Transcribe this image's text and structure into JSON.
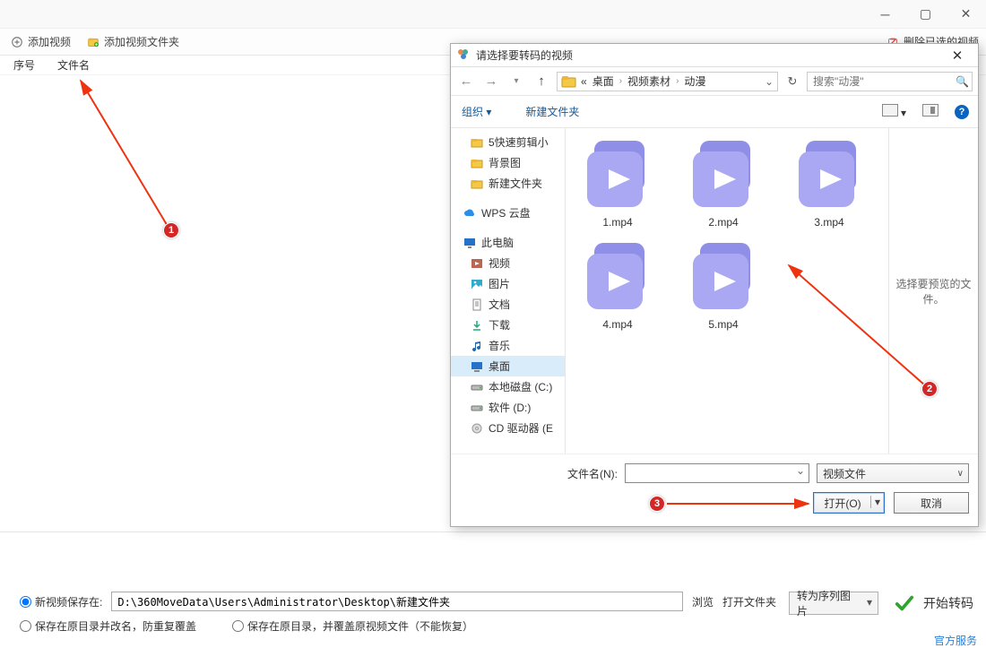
{
  "main_toolbar": {
    "add_video": "添加视频",
    "add_folder": "添加视频文件夹",
    "delete_selected": "删除已选的视频"
  },
  "table": {
    "seq": "序号",
    "filename": "文件名"
  },
  "annotations": {
    "b1": "1",
    "b2": "2",
    "b3": "3"
  },
  "bottom": {
    "save_new_label": "新视频保存在:",
    "save_path": "D:\\360MoveData\\Users\\Administrator\\Desktop\\新建文件夹",
    "browse": "浏览",
    "open_folder": "打开文件夹",
    "rename_label": "保存在原目录并改名，防重复覆盖",
    "overwrite_label": "保存在原目录，并覆盖原视频文件（不能恢复）",
    "seq_img": "转为序列图片",
    "start": "开始转码"
  },
  "footer_link": "官方服务",
  "dialog": {
    "title": "请选择要转码的视频",
    "breadcrumb": {
      "prefix": "«",
      "seg1": "桌面",
      "seg2": "视频素材",
      "seg3": "动漫"
    },
    "search_placeholder": "搜索\"动漫\"",
    "organize": "组织",
    "new_folder": "新建文件夹",
    "tree": {
      "quick": "5快速剪辑小",
      "bg": "背景图",
      "newdir": "新建文件夹",
      "wps": "WPS 云盘",
      "thisPC": "此电脑",
      "video": "视频",
      "pictures": "图片",
      "docs": "文档",
      "downloads": "下载",
      "music": "音乐",
      "desktop": "桌面",
      "c_drive": "本地磁盘 (C:)",
      "d_drive": "软件 (D:)",
      "cd_drive": "CD 驱动器 (E"
    },
    "files": [
      "1.mp4",
      "2.mp4",
      "3.mp4",
      "4.mp4",
      "5.mp4"
    ],
    "preview_hint": "选择要预览的文件。",
    "filename_label": "文件名(N):",
    "filter_label": "视频文件",
    "open_label": "打开(O)",
    "cancel_label": "取消"
  }
}
